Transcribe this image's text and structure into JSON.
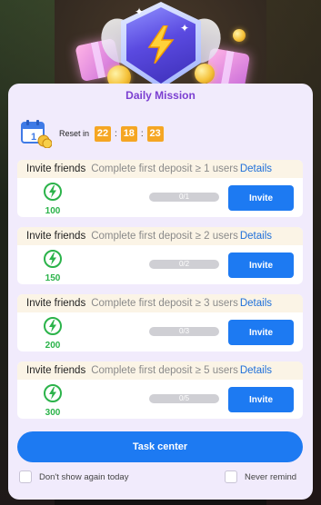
{
  "popup": {
    "title": "Daily Mission",
    "reset_label": "Reset in",
    "timer": {
      "hours": "22",
      "minutes": "18",
      "seconds": "23",
      "separator": ":"
    }
  },
  "tasks": [
    {
      "name": "Invite friends",
      "desc": "Complete first deposit ≥ 1 users",
      "details": "Details",
      "reward": "100",
      "progress_text": "0/1",
      "progress": 0,
      "button": "Invite"
    },
    {
      "name": "Invite friends",
      "desc": "Complete first deposit ≥ 2 users",
      "details": "Details",
      "reward": "150",
      "progress_text": "0/2",
      "progress": 0,
      "button": "Invite"
    },
    {
      "name": "Invite friends",
      "desc": "Complete first deposit ≥ 3 users",
      "details": "Details",
      "reward": "200",
      "progress_text": "0/3",
      "progress": 0,
      "button": "Invite"
    },
    {
      "name": "Invite friends",
      "desc": "Complete first deposit ≥ 5 users",
      "details": "Details",
      "reward": "300",
      "progress_text": "0/5",
      "progress": 0,
      "button": "Invite"
    }
  ],
  "footer": {
    "task_center": "Task center",
    "dont_show": "Don't show again today",
    "never_remind": "Never remind"
  },
  "colors": {
    "accent": "#1d7af2",
    "title": "#7b3fd1",
    "reward": "#2bb34a",
    "timer": "#f5a623",
    "link": "#1e6fd9"
  },
  "icons": {
    "header": "lightning-shield-icon",
    "calendar": "calendar-icon",
    "reward": "lightning-coin-icon"
  }
}
